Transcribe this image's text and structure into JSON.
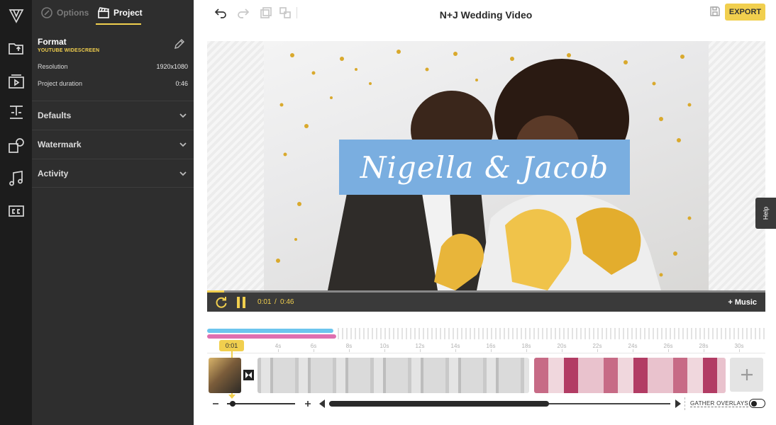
{
  "colors": {
    "accent": "#f1cf4e",
    "panel": "#2e2e2e",
    "rail": "#1c1c1c",
    "banner": "#7aaee0",
    "audio_blue": "#6cc5ee",
    "audio_pink": "#de6fb0"
  },
  "rail": {
    "icons": [
      "logo-icon",
      "folder-upload-icon",
      "media-library-icon",
      "text-icon",
      "shapes-icon",
      "music-note-icon",
      "closed-captions-icon"
    ]
  },
  "panel": {
    "tabs": [
      {
        "label": "Options",
        "icon": "options-icon",
        "active": false
      },
      {
        "label": "Project",
        "icon": "clapperboard-icon",
        "active": true
      }
    ],
    "format": {
      "title": "Format",
      "subtitle": "YOUTUBE WIDESCREEN",
      "rows": [
        {
          "label": "Resolution",
          "value": "1920x1080"
        },
        {
          "label": "Project duration",
          "value": "0:46"
        }
      ]
    },
    "sections": [
      "Defaults",
      "Watermark",
      "Activity"
    ]
  },
  "header": {
    "title": "N+J Wedding Video",
    "export_label": "EXPORT"
  },
  "preview": {
    "title_overlay": "Nigella & Jacob"
  },
  "playback": {
    "current": "0:01",
    "separator": "/",
    "total": "0:46",
    "progress": 0.03,
    "music_label": "+ Music"
  },
  "help_label": "Help",
  "timeline": {
    "playhead_label": "0:01",
    "ticks": [
      "4s",
      "6s",
      "8s",
      "10s",
      "12s",
      "14s",
      "16s",
      "18s",
      "20s",
      "22s",
      "24s",
      "26s",
      "28s",
      "30s"
    ]
  },
  "bottom": {
    "gather_label": "GATHER OVERLAYS",
    "gather_on": false
  }
}
